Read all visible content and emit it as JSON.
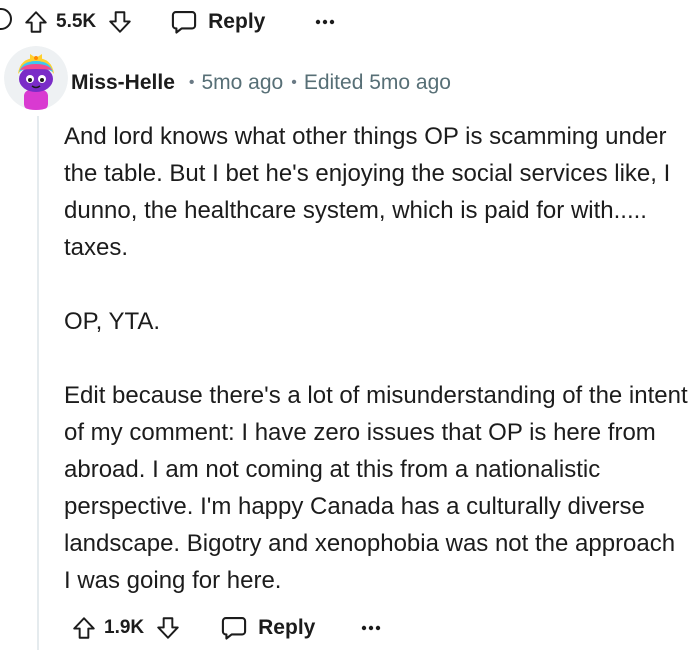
{
  "parent_actions": {
    "score": "5.5K",
    "reply_label": "Reply"
  },
  "comment": {
    "username": "Miss-Helle",
    "time_ago": "5mo ago",
    "edited": "Edited 5mo ago",
    "paragraphs": [
      "And lord knows what other things OP is scamming under the table. But I bet he's enjoying the social services like, I dunno, the healthcare system, which is paid for with..... taxes.",
      "OP, YTA.",
      "Edit because there's a lot of misunderstanding of the intent of my comment: I have zero issues that OP is here from abroad. I am not coming at this from a nationalistic perspective. I'm happy Canada has a culturally diverse landscape. Bigotry and xenophobia was not the approach I was going for here."
    ],
    "actions": {
      "score": "1.9K",
      "reply_label": "Reply"
    }
  },
  "icons": {
    "upvote": "arrow-up-icon",
    "downvote": "arrow-down-icon",
    "reply": "speech-bubble-icon",
    "more": "ellipsis-icon",
    "avatar": "snoo-avatar"
  },
  "colors": {
    "text": "#1c1c1c",
    "meta": "#576f76",
    "thread_line": "#e5ebee"
  }
}
